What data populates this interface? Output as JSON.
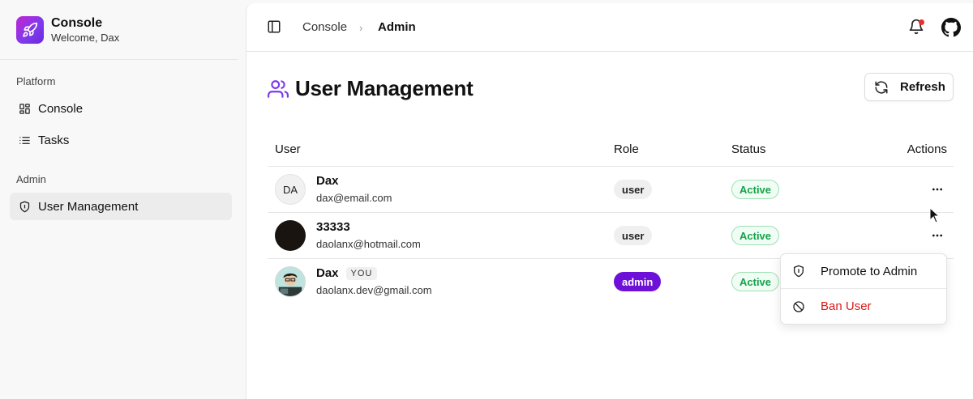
{
  "brand": {
    "title": "Console",
    "subtitle": "Welcome, Dax",
    "icon": "rocket-icon",
    "accent": "#7c3aed"
  },
  "sidebar": {
    "groups": [
      {
        "label": "Platform",
        "items": [
          {
            "label": "Console",
            "icon": "dashboard-icon"
          },
          {
            "label": "Tasks",
            "icon": "list-icon"
          }
        ]
      },
      {
        "label": "Admin",
        "items": [
          {
            "label": "User Management",
            "icon": "shield-icon",
            "active": true
          }
        ]
      }
    ]
  },
  "topbar": {
    "breadcrumb": [
      "Console",
      "Admin"
    ],
    "notification_dot_color": "#ef2b2b"
  },
  "page": {
    "title": "User Management",
    "refresh_label": "Refresh"
  },
  "table": {
    "columns": [
      "User",
      "Role",
      "Status",
      "Actions"
    ],
    "rows": [
      {
        "name": "Dax",
        "email": "dax@email.com",
        "avatar": "DA",
        "role": "user",
        "status": "Active",
        "you": ""
      },
      {
        "name": "33333",
        "email": "daolanx@hotmail.com",
        "avatar": "",
        "role": "user",
        "status": "Active",
        "you": ""
      },
      {
        "name": "Dax",
        "email": "daolanx.dev@gmail.com",
        "avatar": "",
        "role": "admin",
        "status": "Active",
        "you": "YOU"
      }
    ]
  },
  "actions_menu": {
    "items": [
      {
        "label": "Promote to Admin",
        "icon": "shield-icon"
      },
      {
        "label": "Ban User",
        "icon": "ban-icon",
        "color": "#dc1a1a"
      }
    ]
  }
}
